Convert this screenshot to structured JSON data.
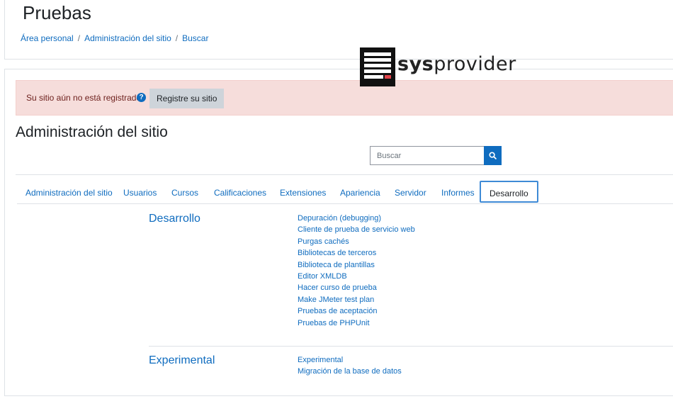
{
  "page_title": "Pruebas",
  "breadcrumb": [
    {
      "label": "Área personal"
    },
    {
      "label": "Administración del sitio"
    },
    {
      "label": "Buscar"
    }
  ],
  "logo": {
    "text_bold": "sys",
    "text_regular": "provider",
    "icon": "server-icon"
  },
  "alert": {
    "message": "Su sitio aún no está registrado.",
    "help_icon": "question-circle-icon",
    "button_label": "Registre su sitio"
  },
  "section_title": "Administración del sitio",
  "search": {
    "placeholder": "Buscar",
    "icon": "search-icon"
  },
  "tabs": [
    {
      "label": "Administración del sitio",
      "active": false
    },
    {
      "label": "Usuarios",
      "active": false
    },
    {
      "label": "Cursos",
      "active": false
    },
    {
      "label": "Calificaciones",
      "active": false
    },
    {
      "label": "Extensiones",
      "active": false
    },
    {
      "label": "Apariencia",
      "active": false
    },
    {
      "label": "Servidor",
      "active": false
    },
    {
      "label": "Informes",
      "active": false
    },
    {
      "label": "Desarrollo",
      "active": true
    }
  ],
  "categories": [
    {
      "title": "Desarrollo",
      "links": [
        "Depuración (debugging)",
        "Cliente de prueba de servicio web",
        "Purgas cachés",
        "Bibliotecas de terceros",
        "Biblioteca de plantillas",
        "Editor XMLDB",
        "Hacer curso de prueba",
        "Make JMeter test plan",
        "Pruebas de aceptación",
        "Pruebas de PHPUnit"
      ]
    },
    {
      "title": "Experimental",
      "links": [
        "Experimental",
        "Migración de la base de datos"
      ]
    }
  ],
  "colors": {
    "link": "#0f6cbf",
    "alert_bg": "#f6dddb",
    "alert_text": "#6e211e",
    "active_tab_border": "#3e8ad6"
  }
}
